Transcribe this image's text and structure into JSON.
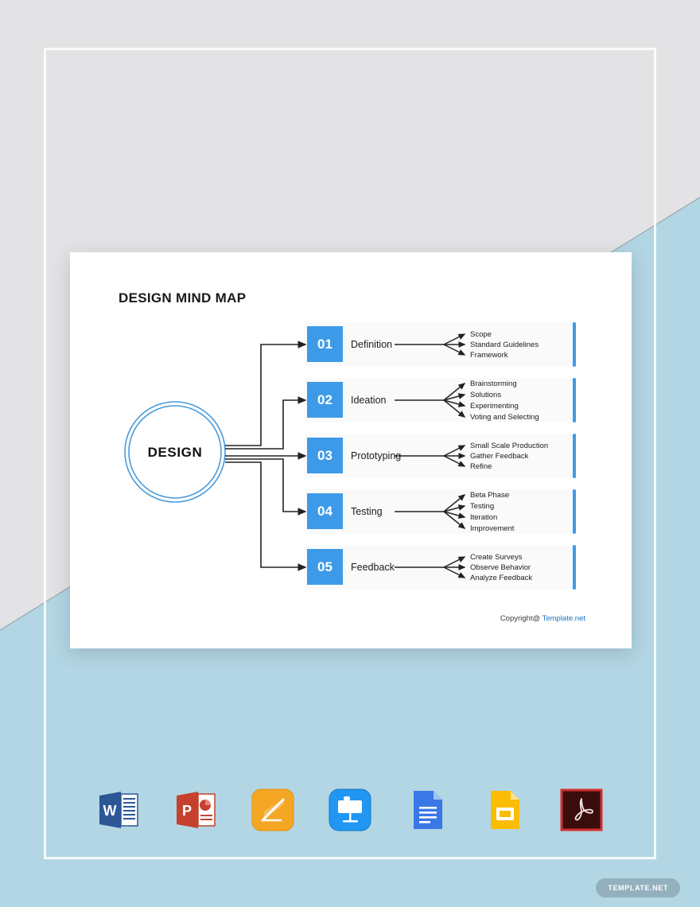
{
  "document": {
    "title": "DESIGN MIND MAP",
    "hub": {
      "label": "DESIGN"
    },
    "copyright": {
      "prefix": "Copyright@ ",
      "link": "Template.net"
    },
    "branches": [
      {
        "number": "01",
        "label": "Definition",
        "items": [
          "Scope",
          "Standard Guidelines",
          "Framework"
        ]
      },
      {
        "number": "02",
        "label": "Ideation",
        "items": [
          "Brainstorming",
          "Solutions",
          "Experimenting",
          "Voting and Selecting"
        ]
      },
      {
        "number": "03",
        "label": "Prototyping",
        "items": [
          "Small Scale Production",
          "Gather Feedback",
          "Refine"
        ]
      },
      {
        "number": "04",
        "label": "Testing",
        "items": [
          "Beta Phase",
          "Testing",
          "Iteration",
          "Improvement"
        ]
      },
      {
        "number": "05",
        "label": "Feedback",
        "items": [
          "Create Surveys",
          "Observe Behavior",
          "Analyze Feedback"
        ]
      }
    ]
  },
  "formats": [
    {
      "name": "word-icon",
      "label": "Word"
    },
    {
      "name": "powerpoint-icon",
      "label": "PowerPoint"
    },
    {
      "name": "pages-icon",
      "label": "Pages"
    },
    {
      "name": "keynote-icon",
      "label": "Keynote"
    },
    {
      "name": "google-docs-icon",
      "label": "Google Docs"
    },
    {
      "name": "google-slides-icon",
      "label": "Google Slides"
    },
    {
      "name": "pdf-icon",
      "label": "PDF"
    }
  ],
  "watermark": {
    "label": "TEMPLATE.NET"
  },
  "colors": {
    "accent_blue": "#3d9ae8",
    "hub_ring": "#4a9bd8",
    "link_blue": "#1a73c8",
    "page_gray": "#e3e3e5",
    "page_blue": "#b3d6e4",
    "row_strip": "#fafafa",
    "connector": "#222222"
  }
}
